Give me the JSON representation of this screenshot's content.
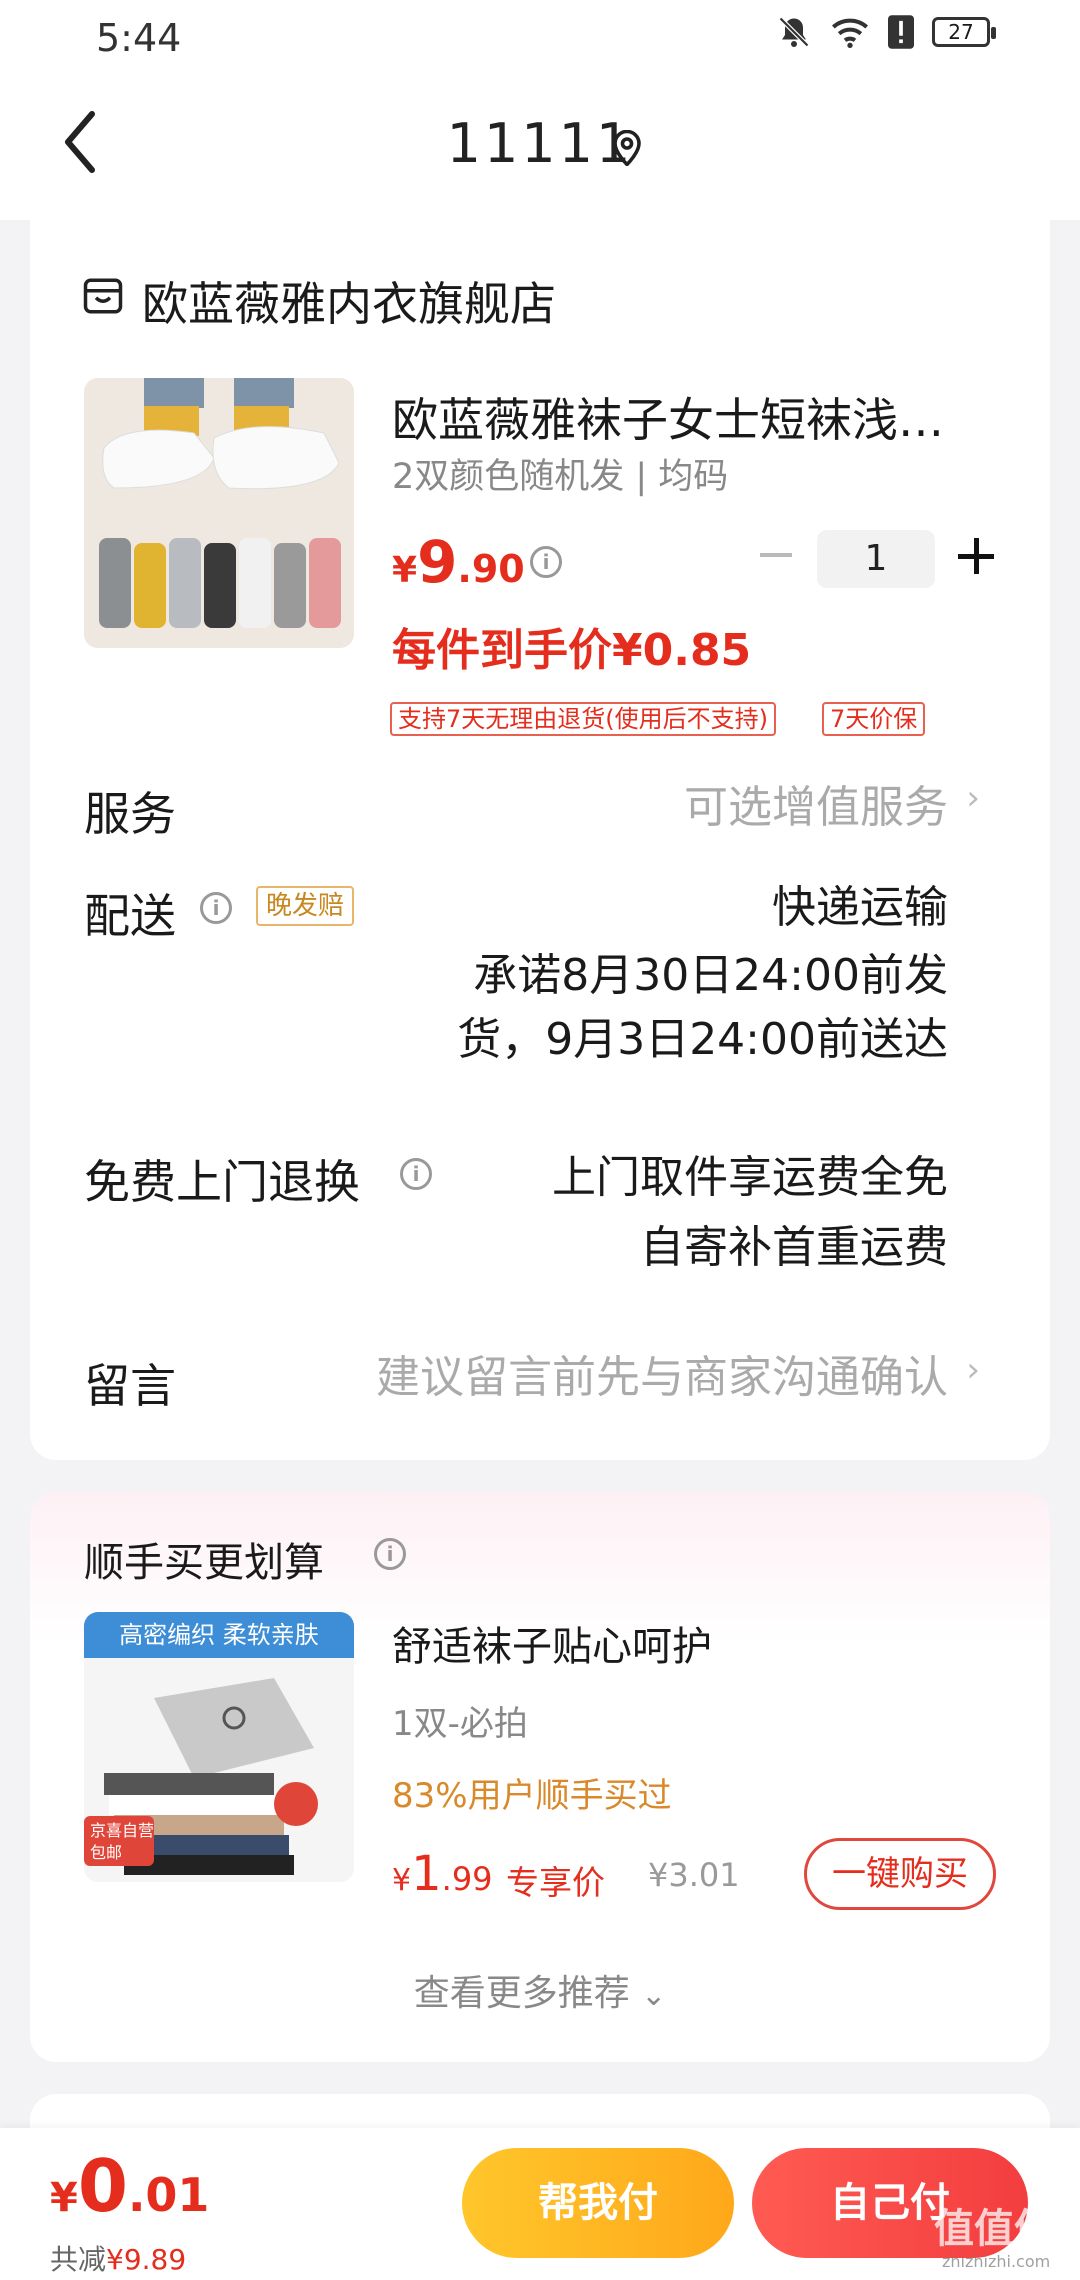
{
  "status_bar": {
    "time": "5:44",
    "battery": "27"
  },
  "header": {
    "title": "11111"
  },
  "shop": {
    "name": "欧蓝薇雅内衣旗舰店"
  },
  "product": {
    "title": "欧蓝薇雅袜子女士短袜浅…",
    "spec": "2双颜色随机发 | 均码",
    "price_currency": "¥",
    "price_int": "9",
    "price_dec": ".90",
    "quantity": "1",
    "unit_price": "每件到手价¥0.85",
    "tags": [
      "支持7天无理由退货(使用后不支持)",
      "7天价保"
    ]
  },
  "rows": {
    "service_label": "服务",
    "service_value": "可选增值服务",
    "delivery_label": "配送",
    "delivery_badge": "晚发赔",
    "delivery_method": "快递运输",
    "delivery_promise_1": "承诺8月30日24:00前发",
    "delivery_promise_2": "货，9月3日24:00前送达",
    "return_label": "免费上门退换",
    "return_value_1": "上门取件享运费全免",
    "return_value_2": "自寄补首重运费",
    "message_label": "留言",
    "message_placeholder": "建议留言前先与商家沟通确认"
  },
  "recommend": {
    "title": "顺手买更划算",
    "image_banner": "高密编织 柔软亲肤",
    "image_badge": "京喜自营\n包邮",
    "name": "舒适袜子贴心呵护",
    "spec": "1双-必拍",
    "bought": "83%用户顺手买过",
    "price_currency": "¥",
    "price_int": "1",
    "price_dec": ".99",
    "exclusive_label": "专享价",
    "original_price": "¥3.01",
    "buy_button": "一键购买",
    "more_link": "查看更多推荐"
  },
  "bottom": {
    "total_currency": "¥",
    "total_int": "0",
    "total_dec": ".01",
    "saved_label": "共减",
    "saved_amount": "¥9.89",
    "help_pay": "帮我付",
    "self_pay": "自己付",
    "watermark": "值值值",
    "watermark_sub": "zhizhizhi.com"
  },
  "colors": {
    "accent_red": "#e52d1e",
    "yellow_button": "#ffb822",
    "red_button": "#f33d3f",
    "orange_text": "#d9892a"
  },
  "icons": [
    "back-arrow",
    "location-pin",
    "shop-bag",
    "info-circle",
    "chevron-right",
    "chevron-down",
    "bell-off",
    "wifi",
    "battery"
  ]
}
